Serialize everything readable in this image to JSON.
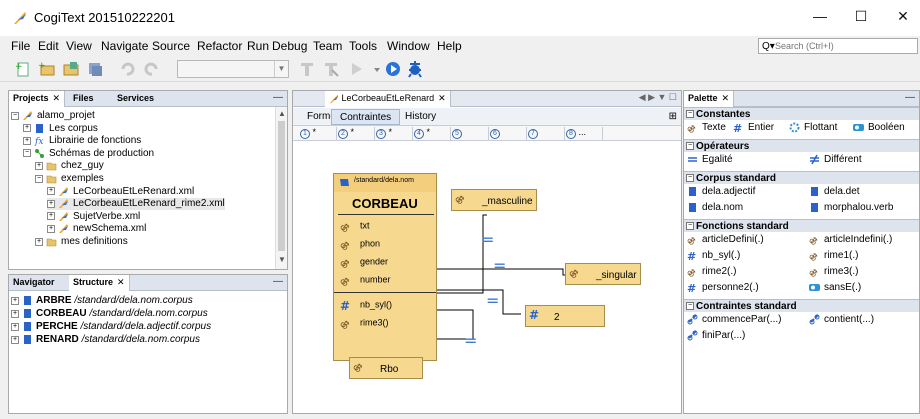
{
  "window": {
    "title": "CogiText 201510222201",
    "controls": {
      "minimize": "—",
      "maximize": "☐",
      "close": "✕"
    }
  },
  "menu": [
    "File",
    "Edit",
    "View",
    "Navigate",
    "Source",
    "Refactor",
    "Run",
    "Debug",
    "Team",
    "Tools",
    "Window",
    "Help"
  ],
  "search": {
    "placeholder": "Search (Ctrl+I)",
    "icon": "Q▾"
  },
  "projects_panel": {
    "tabs": [
      "Projects",
      "Files",
      "Services"
    ],
    "close": "✕",
    "minimize": "—",
    "tree": [
      {
        "label": "alamo_projet",
        "icon": "project-icon",
        "expander": "−"
      },
      {
        "label": "Les corpus",
        "icon": "corpus-icon",
        "expander": "+"
      },
      {
        "label": "Librairie de fonctions",
        "icon": "function-library-icon",
        "expander": "+"
      },
      {
        "label": "Schémas de production",
        "icon": "schema-icon",
        "expander": "−"
      },
      {
        "label": "chez_guy",
        "icon": "folder-icon",
        "expander": "+"
      },
      {
        "label": "exemples",
        "icon": "folder-icon",
        "expander": "−"
      },
      {
        "label": "LeCorbeauEtLeRenard.xml",
        "icon": "xml-schema-icon",
        "expander": "+"
      },
      {
        "label": "LeCorbeauEtLeRenard_rime2.xml",
        "icon": "xml-schema-icon",
        "expander": "+"
      },
      {
        "label": "SujetVerbe.xml",
        "icon": "xml-schema-icon",
        "expander": "+"
      },
      {
        "label": "newSchema.xml",
        "icon": "xml-schema-icon",
        "expander": "+"
      },
      {
        "label": "mes definitions",
        "icon": "folder-icon",
        "expander": "+"
      }
    ],
    "scroll": {
      "up": "▲",
      "down": "▼"
    }
  },
  "navigator_panel": {
    "tabs": [
      "Navigator",
      "Structure"
    ],
    "close": "✕",
    "minimize": "—",
    "items": [
      {
        "name": "ARBRE",
        "path": "/standard/dela.nom.corpus"
      },
      {
        "name": "CORBEAU",
        "path": "/standard/dela.nom.corpus"
      },
      {
        "name": "PERCHE",
        "path": "/standard/dela.adjectif.corpus"
      },
      {
        "name": "RENARD",
        "path": "/standard/dela.nom.corpus"
      }
    ],
    "expander": "+"
  },
  "editor": {
    "tab": {
      "label": "LeCorbeauEtLeRenard",
      "close": "✕"
    },
    "tab_nav": "◀ ▶ ▼ ☐",
    "subtabs": [
      "Forme",
      "Contraintes",
      "History"
    ],
    "active_subtab": "Contraintes",
    "steps": [
      {
        "num": "1",
        "mark": "*"
      },
      {
        "num": "2",
        "mark": "*"
      },
      {
        "num": "3",
        "mark": "*"
      },
      {
        "num": "4",
        "mark": "*"
      },
      {
        "num": "5",
        "mark": ""
      },
      {
        "num": "6",
        "mark": ""
      },
      {
        "num": "7",
        "mark": ""
      },
      {
        "num": "8",
        "mark": "..."
      }
    ],
    "diagram": {
      "main_node": {
        "path": "/standard/dela.nom",
        "title": "CORBEAU",
        "attributes": [
          {
            "label": "txt",
            "icon": "string-icon"
          },
          {
            "label": "phon",
            "icon": "string-icon"
          },
          {
            "label": "gender",
            "icon": "string-icon"
          },
          {
            "label": "number",
            "icon": "string-icon"
          },
          {
            "label": "nb_syl()",
            "icon": "integer-icon"
          },
          {
            "label": "rime3()",
            "icon": "string-icon"
          }
        ]
      },
      "nodes": [
        {
          "label": "_masculine",
          "icon": "string-icon"
        },
        {
          "label": "_singular",
          "icon": "string-icon"
        },
        {
          "label": "2",
          "icon": "integer-icon"
        },
        {
          "label": "Rbo",
          "icon": "string-icon"
        }
      ],
      "equals": "="
    }
  },
  "palette": {
    "tab": "Palette",
    "close": "✕",
    "minimize": "—",
    "sections": [
      {
        "title": "Constantes",
        "items": [
          {
            "label": "Texte",
            "icon": "string-icon"
          },
          {
            "label": "Entier",
            "icon": "integer-icon"
          },
          {
            "label": "Flottant",
            "icon": "float-icon"
          },
          {
            "label": "Booléen",
            "icon": "boolean-icon"
          }
        ]
      },
      {
        "title": "Opérateurs",
        "items": [
          {
            "label": "Egalité",
            "icon": "equals-icon"
          },
          {
            "label": "Différent",
            "icon": "not-equals-icon"
          }
        ]
      },
      {
        "title": "Corpus standard",
        "items": [
          {
            "label": "dela.adjectif",
            "icon": "corpus-icon"
          },
          {
            "label": "dela.det",
            "icon": "corpus-icon"
          },
          {
            "label": "dela.nom",
            "icon": "corpus-icon"
          },
          {
            "label": "morphalou.verb",
            "icon": "corpus-icon"
          }
        ]
      },
      {
        "title": "Fonctions standard",
        "items": [
          {
            "label": "articleDefini(.)",
            "icon": "string-icon"
          },
          {
            "label": "articleIndefini(.)",
            "icon": "string-icon"
          },
          {
            "label": "nb_syl(.)",
            "icon": "integer-icon"
          },
          {
            "label": "rime1(.)",
            "icon": "string-icon"
          },
          {
            "label": "rime2(.)",
            "icon": "string-icon"
          },
          {
            "label": "rime3(.)",
            "icon": "string-icon"
          },
          {
            "label": "personne2(.)",
            "icon": "integer-icon"
          },
          {
            "label": "sansE(.)",
            "icon": "boolean-icon"
          }
        ]
      },
      {
        "title": "Contraintes standard",
        "items": [
          {
            "label": "commencePar(...)",
            "icon": "link-icon"
          },
          {
            "label": "contient(...)",
            "icon": "link-icon"
          },
          {
            "label": "finiPar(...)",
            "icon": "link-icon"
          }
        ]
      }
    ]
  },
  "colors": {
    "node_fill": "#f6d88f",
    "link_blue": "#3364a8",
    "equals_blue": "#3a7bd5",
    "tab_header": "#dde4ee"
  }
}
